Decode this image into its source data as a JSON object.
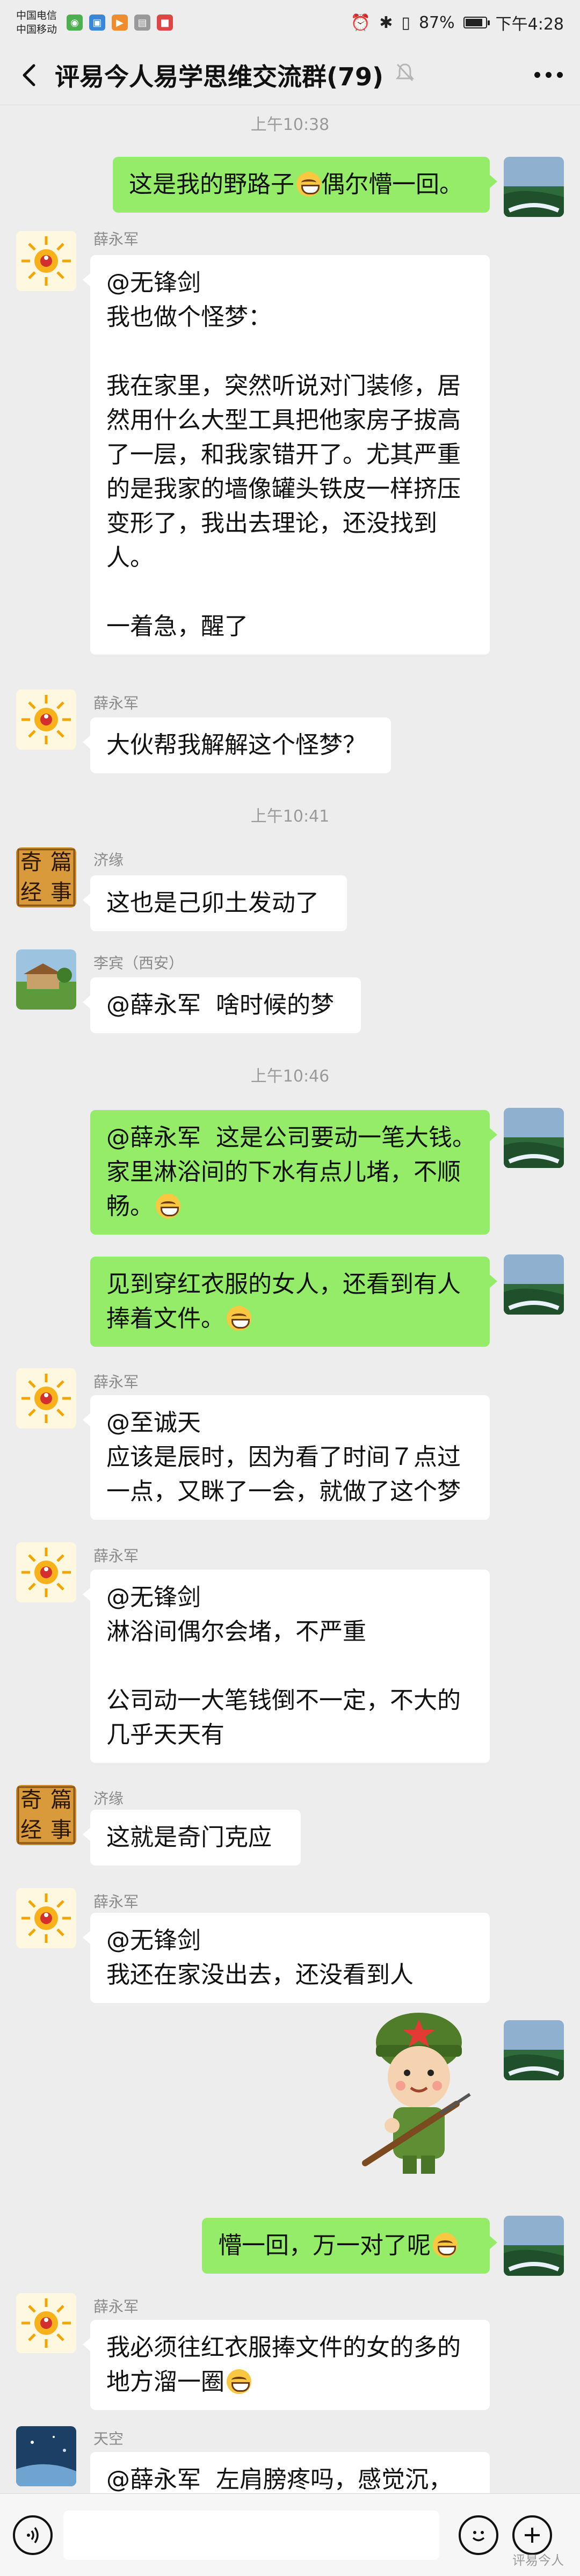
{
  "status_bar": {
    "carrier1": "中国电信",
    "carrier2": "中国移动",
    "battery": "87%",
    "battery_level": 0.87,
    "time": "下午4:28"
  },
  "header": {
    "title": "评易今人易学思维交流群(79)"
  },
  "times": [
    "上午10:38",
    "上午10:41",
    "上午10:46"
  ],
  "senders": {
    "xue": "薛永军",
    "jiyuan": "济缘",
    "libin": "李宾（西安）",
    "tiankong": "天空"
  },
  "messages": {
    "m1": [
      "这是我的野路子",
      "偶尔懵一回。"
    ],
    "m2": [
      "@无锋剑",
      "我也做个怪梦：",
      "",
      "我在家里，突然听说对门装修，居",
      "然用什么大型工具把他家房子拔高",
      "了一层，和我家错开了。尤其严重",
      "的是我家的墙像罐头铁皮一样挤压",
      "变形了，我出去理论，还没找到",
      "人。",
      "",
      "一着急，醒了"
    ],
    "m3": "大伙帮我解解这个怪梦？",
    "m4": "这也是己卯土发动了",
    "m5": "@薛永军  啥时候的梦",
    "m6": [
      "@薛永军  这是公司要动一笔大钱。",
      "家里淋浴间的下水有点儿堵，不顺",
      "畅。"
    ],
    "m7": [
      "见到穿红衣服的女人，还看到有人",
      "捧着文件。"
    ],
    "m8": [
      "@至诚天",
      "应该是辰时，因为看了时间７点过",
      "一点，又眯了一会，就做了这个梦"
    ],
    "m9": [
      "@无锋剑",
      "淋浴间偶尔会堵，不严重",
      "",
      "公司动一大笔钱倒不一定，不大的",
      "几乎天天有"
    ],
    "m10": "这就是奇门克应",
    "m11": [
      "@无锋剑",
      "我还在家没出去，还没看到人"
    ],
    "m13": "懵一回，万一对了呢",
    "m14": [
      "我必须往红衣服捧文件的女的多的",
      "地方溜一圈"
    ],
    "m15": "@薛永军  左肩膀疼吗，感觉沉，"
  },
  "avatar_text": {
    "jiyuan": [
      "奇",
      "篇",
      "经",
      "事"
    ]
  },
  "watermark": "评易今人"
}
